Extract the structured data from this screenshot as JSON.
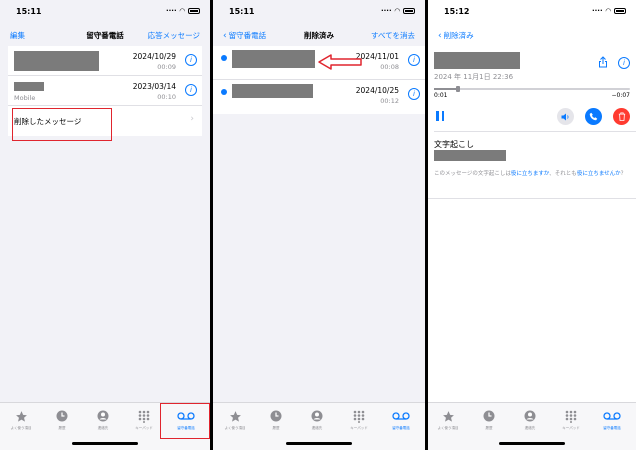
{
  "status": {
    "time1": "15:11",
    "time2": "15:11",
    "time3": "15:12"
  },
  "screen1": {
    "nav_left": "編集",
    "nav_title": "留守番電話",
    "nav_right": "応答メッセージ",
    "items": [
      {
        "date": "2024/10/29",
        "duration": "00:09",
        "subtitle": ""
      },
      {
        "date": "2023/03/14",
        "duration": "00:10",
        "subtitle": "Mobile"
      }
    ],
    "deleted_label": "削除したメッセージ"
  },
  "screen2": {
    "nav_back": "留守番電話",
    "nav_title": "削除済み",
    "nav_right": "すべてを消去",
    "items": [
      {
        "date": "2024/11/01",
        "duration": "00:08"
      },
      {
        "date": "2024/10/25",
        "duration": "00:12"
      }
    ]
  },
  "screen3": {
    "nav_back": "削除済み",
    "date_line": "2024 年 11月1日 22:36",
    "time_start": "0:01",
    "time_end": "−0:07",
    "progress": 0.12,
    "transcript_title": "文字起こし",
    "feedback_pre": "このメッセージの文字起こしは",
    "feedback_link1": "役に立ちますか",
    "feedback_mid": "、それとも",
    "feedback_link2": "役に立ちませんか",
    "feedback_end": "？"
  },
  "tabs": [
    {
      "label": "よく使う項目",
      "icon": "star-icon"
    },
    {
      "label": "履歴",
      "icon": "clock-icon"
    },
    {
      "label": "連絡先",
      "icon": "person-icon"
    },
    {
      "label": "キーパッド",
      "icon": "keypad-icon"
    },
    {
      "label": "留守番電話",
      "icon": "voicemail-icon"
    }
  ],
  "colors": {
    "accent": "#0a7aff",
    "highlight": "#e0252e",
    "redaction": "#7b7b7b",
    "delete": "#ff3b30"
  }
}
